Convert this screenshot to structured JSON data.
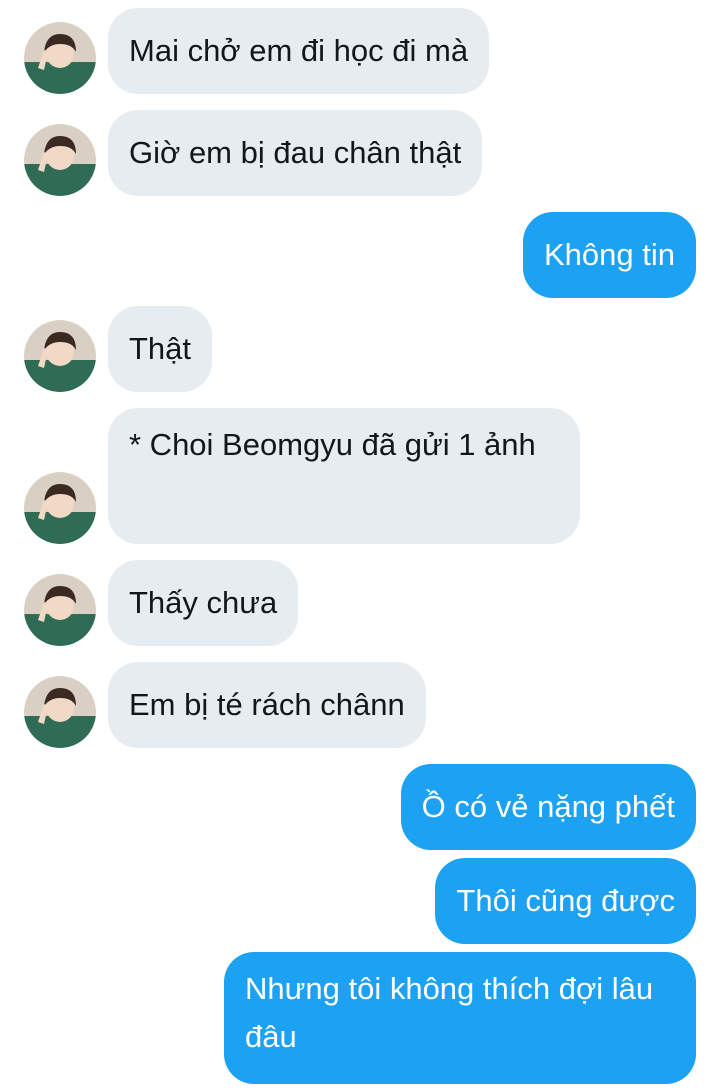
{
  "contact": {
    "avatar_icon": "user-avatar-photo"
  },
  "colors": {
    "incoming_bubble": "#e6ecf0",
    "outgoing_bubble": "#1da1f2",
    "incoming_text": "#14171a",
    "outgoing_text": "#ffffff"
  },
  "messages": [
    {
      "side": "in",
      "text": "Mai chở em đi học đi mà"
    },
    {
      "side": "in",
      "text": "Giờ em bị đau chân thật"
    },
    {
      "side": "out",
      "text": "Không tin"
    },
    {
      "side": "in",
      "text": "Thật"
    },
    {
      "side": "in",
      "text": "* Choi Beomgyu đã gửi 1 ảnh"
    },
    {
      "side": "in",
      "text": "Thấy chưa"
    },
    {
      "side": "in",
      "text": "Em bị té rách chânn"
    },
    {
      "side": "out",
      "text": "Ồ có vẻ nặng phết"
    },
    {
      "side": "out",
      "text": "Thôi cũng được"
    },
    {
      "side": "out",
      "text": "Nhưng tôi không thích đợi lâu đâu"
    }
  ]
}
